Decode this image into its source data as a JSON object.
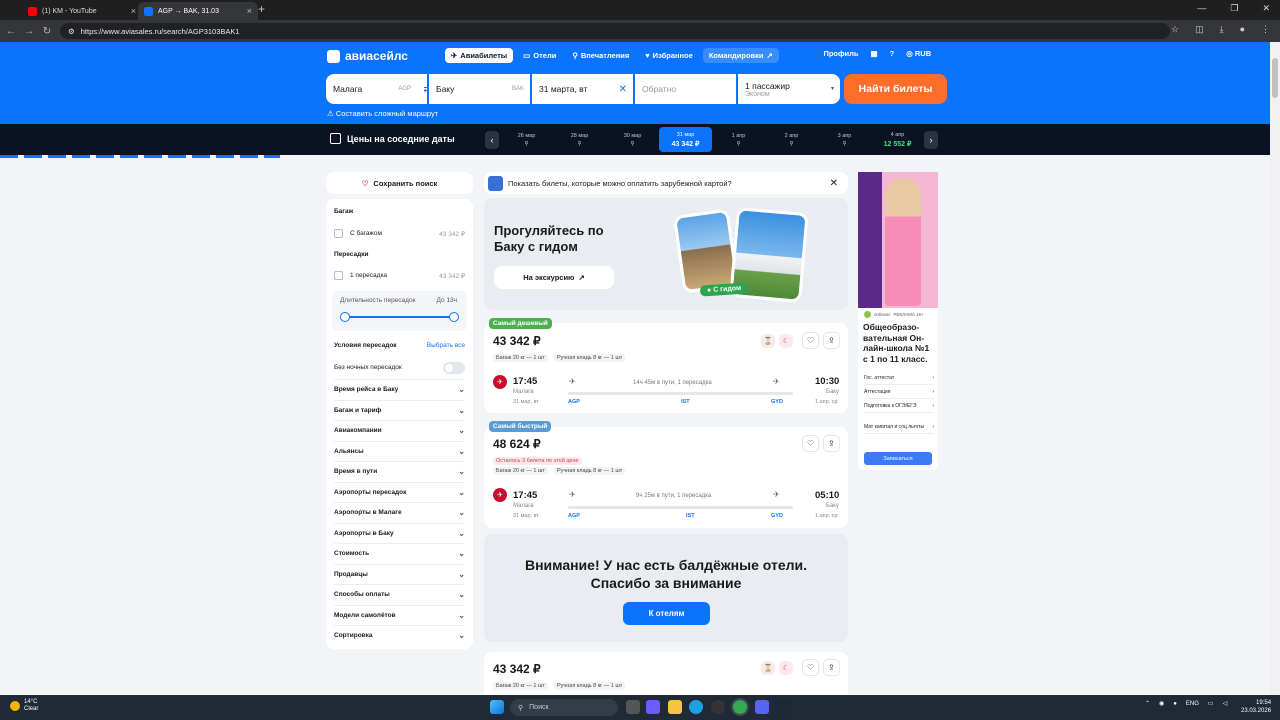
{
  "browser": {
    "tabs": [
      {
        "title": "(1) KM - YouTube"
      },
      {
        "title": "AGP → BAK, 31.03"
      }
    ],
    "url": "https://www.aviasales.ru/search/AGP3103BAK1"
  },
  "header": {
    "logo": "авиасейлс",
    "nav": [
      {
        "label": "Авиабилеты"
      },
      {
        "label": "Отели"
      },
      {
        "label": "Впечатления"
      },
      {
        "label": "Избранное"
      },
      {
        "label": "Командировки"
      }
    ],
    "profile": "Профиль",
    "currency": "RUB"
  },
  "search": {
    "origin": "Малага",
    "origin_code": "AGP",
    "destination": "Баку",
    "destination_code": "BAK",
    "date": "31 марта, вт",
    "return_placeholder": "Обратно",
    "passengers": "1 пассажир",
    "cabin": "Эконом",
    "button": "Найти билеты",
    "complex_route": "Составить сложный маршрут"
  },
  "datebar": {
    "title": "Цены на соседние даты",
    "dates": [
      {
        "date": "26 мар",
        "price": ""
      },
      {
        "date": "28 мар",
        "price": ""
      },
      {
        "date": "30 мар",
        "price": ""
      },
      {
        "date": "31 мар",
        "price": "43 342 ₽"
      },
      {
        "date": "1 апр",
        "price": ""
      },
      {
        "date": "2 апр",
        "price": ""
      },
      {
        "date": "3 апр",
        "price": ""
      },
      {
        "date": "4 апр",
        "price": "12 552 ₽"
      }
    ]
  },
  "sidebar": {
    "save": "Сохранить поиск",
    "baggage_title": "Багаж",
    "baggage_option": "С багажом",
    "baggage_price": "43 342 ₽",
    "transfers_title": "Пересадки",
    "transfers_option": "1 пересадка",
    "transfers_price": "43 342 ₽",
    "duration_label": "Длительность пересадок",
    "duration_value": "До 13ч",
    "conditions_title": "Условия пересадок",
    "select_all": "Выбрать все",
    "no_night": "Без ночных пересадок",
    "accordions": [
      "Время рейса в Баку",
      "Багаж и тариф",
      "Авиакомпании",
      "Альянсы",
      "Время в пути",
      "Аэропорты пересадок",
      "Аэропорты в Малаге",
      "Аэропорты в Баку",
      "Стоимость",
      "Продавцы",
      "Способы оплаты",
      "Модели самолётов",
      "Сортировка"
    ]
  },
  "main": {
    "foreign_card": "Показать билеты, которые можно оплатить зарубежной картой?",
    "promo_title": "Прогуляйтесь по Баку с гидом",
    "promo_button": "На экскурсию",
    "promo_badge": "С гидом",
    "tickets": [
      {
        "badge": "Самый дешевый",
        "badge_color": "#4caf50",
        "price": "43 342 ₽",
        "warning": "",
        "baggage": "Багаж 20 кг — 1 шт",
        "hand": "Ручная кладь 8 кг — 1 шт",
        "dep_time": "17:45",
        "dep_city": "Малага",
        "dep_date": "31 мар, вт",
        "duration": "14ч 45м в пути, 1 пересадка",
        "arr_time": "10:30",
        "arr_city": "Баку",
        "arr_date": "1 апр, ср",
        "codes": [
          "AGP",
          "IST",
          "GYD"
        ]
      },
      {
        "badge": "Самый быстрый",
        "badge_color": "#5b9bd5",
        "price": "48 624 ₽",
        "warning": "Осталось 3 билета по этой цене",
        "baggage": "Багаж 20 кг — 1 шт",
        "hand": "Ручная кладь 8 кг — 1 шт",
        "dep_time": "17:45",
        "dep_city": "Малага",
        "dep_date": "31 мар, вт",
        "duration": "9ч 25м в пути, 1 пересадка",
        "arr_time": "05:10",
        "arr_city": "Баку",
        "arr_date": "1 апр, ср",
        "codes": [
          "AGP",
          "IST",
          "GYD"
        ]
      },
      {
        "price": "43 342 ₽",
        "baggage": "Багаж 20 кг — 1 шт",
        "hand": "Ручная кладь 8 кг — 1 шт"
      }
    ],
    "hotels_title": "Внимание! У нас есть балдёжные отели. Спасибо за внимание",
    "hotels_button": "К отелям"
  },
  "ad": {
    "brand": "onlinesc",
    "label": "РЕКЛАМА 16+",
    "headline": "Общеобразо-вательная Он-лайн-школа №1 с 1 по 11 класс.",
    "links": [
      "Гос. аттестат",
      "Аттестация",
      "Подготовка к ОГЭ/ЕГЭ",
      "Мат капитал и соц льготы"
    ],
    "button": "Записаться"
  },
  "taskbar": {
    "temp": "14°C",
    "weather": "Clear",
    "search": "Поиск",
    "lang": "ENG",
    "time": "19:54",
    "date": "23.03.2026"
  }
}
